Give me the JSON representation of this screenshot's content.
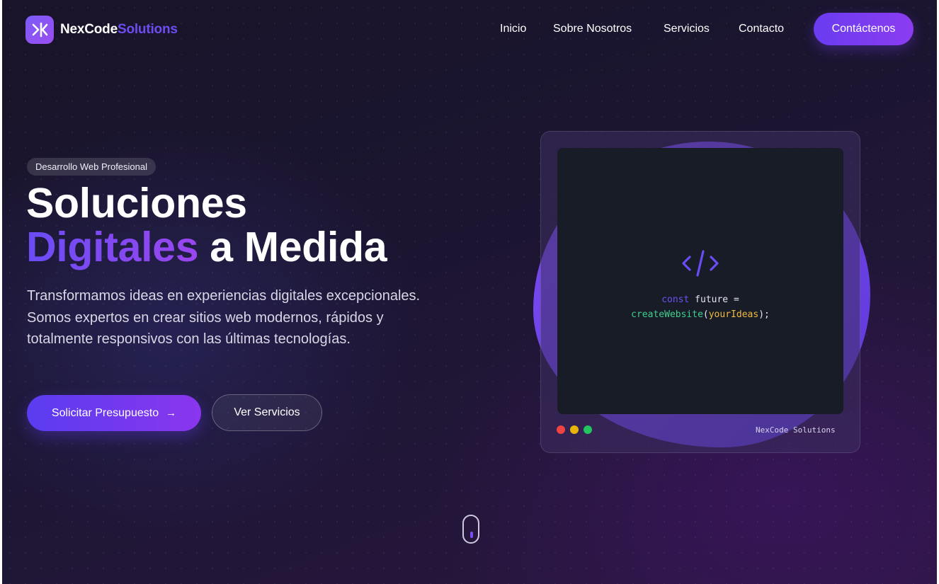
{
  "brand": {
    "name_main": "NexCode",
    "name_accent": "Solutions",
    "logo_icon": "chevron-code-logo"
  },
  "nav": {
    "links": [
      "Inicio",
      "Sobre Nosotros",
      "Servicios",
      "Contacto"
    ],
    "cta": "Contáctenos"
  },
  "hero": {
    "badge": "Desarrollo Web Profesional",
    "title_line1": "Soluciones",
    "title_highlight": "Digitales",
    "title_rest": " a Medida",
    "description": "Transformamos ideas en experiencias digitales excepcionales. Somos expertos en crear sitios web modernos, rápidos y totalmente responsivos con las últimas tecnologías.",
    "primary_button": "Solicitar Presupuesto",
    "primary_arrow": "→",
    "secondary_button": "Ver Servicios"
  },
  "mockup": {
    "code_kw": "const",
    "code_var": " future ",
    "code_eq": "=",
    "code_fn": "createWebsite",
    "code_open": "(",
    "code_arg": "yourIdeas",
    "code_close": ");",
    "footer_label": "NexCode Solutions",
    "window_dots": [
      "#ef4444",
      "#eab308",
      "#22c55e"
    ]
  },
  "colors": {
    "accent": "#6d4cf0",
    "accent2": "#8b3cf0",
    "background": "#1b1530"
  }
}
